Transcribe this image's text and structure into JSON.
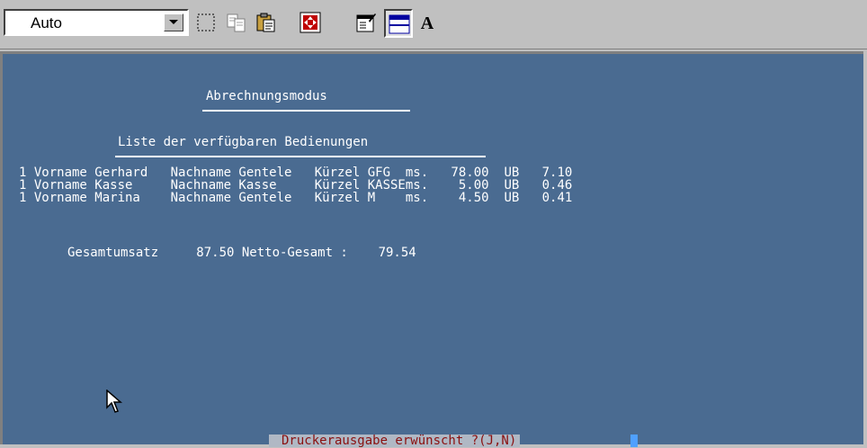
{
  "toolbar": {
    "font_select_value": "Auto",
    "icons": [
      "select-rect-icon",
      "copy-icon",
      "paste-icon",
      "fullscreen-icon",
      "properties-icon",
      "background-icon",
      "font-icon"
    ],
    "font_button_label": "A"
  },
  "terminal": {
    "title": "Abrechnungsmodus",
    "subtitle": "Liste der verfügbaren Bedienungen",
    "rows": [
      "1 Vorname Gerhard   Nachname Gentele   Kürzel GFG  ms.   78.00  UB   7.10",
      "1 Vorname Kasse     Nachname Kasse     Kürzel KASSEms.    5.00  UB   0.46",
      "1 Vorname Marina    Nachname Gentele   Kürzel M    ms.    4.50  UB   0.41"
    ],
    "totals": "Gesamtumsatz     87.50 Netto-Gesamt :    79.54",
    "prompt": "Druckerausgabe erwünscht ?(J,N)"
  },
  "colors": {
    "terminal_background": "#4a6b91",
    "terminal_text": "#ffffff",
    "prompt_text": "#8a1010"
  }
}
